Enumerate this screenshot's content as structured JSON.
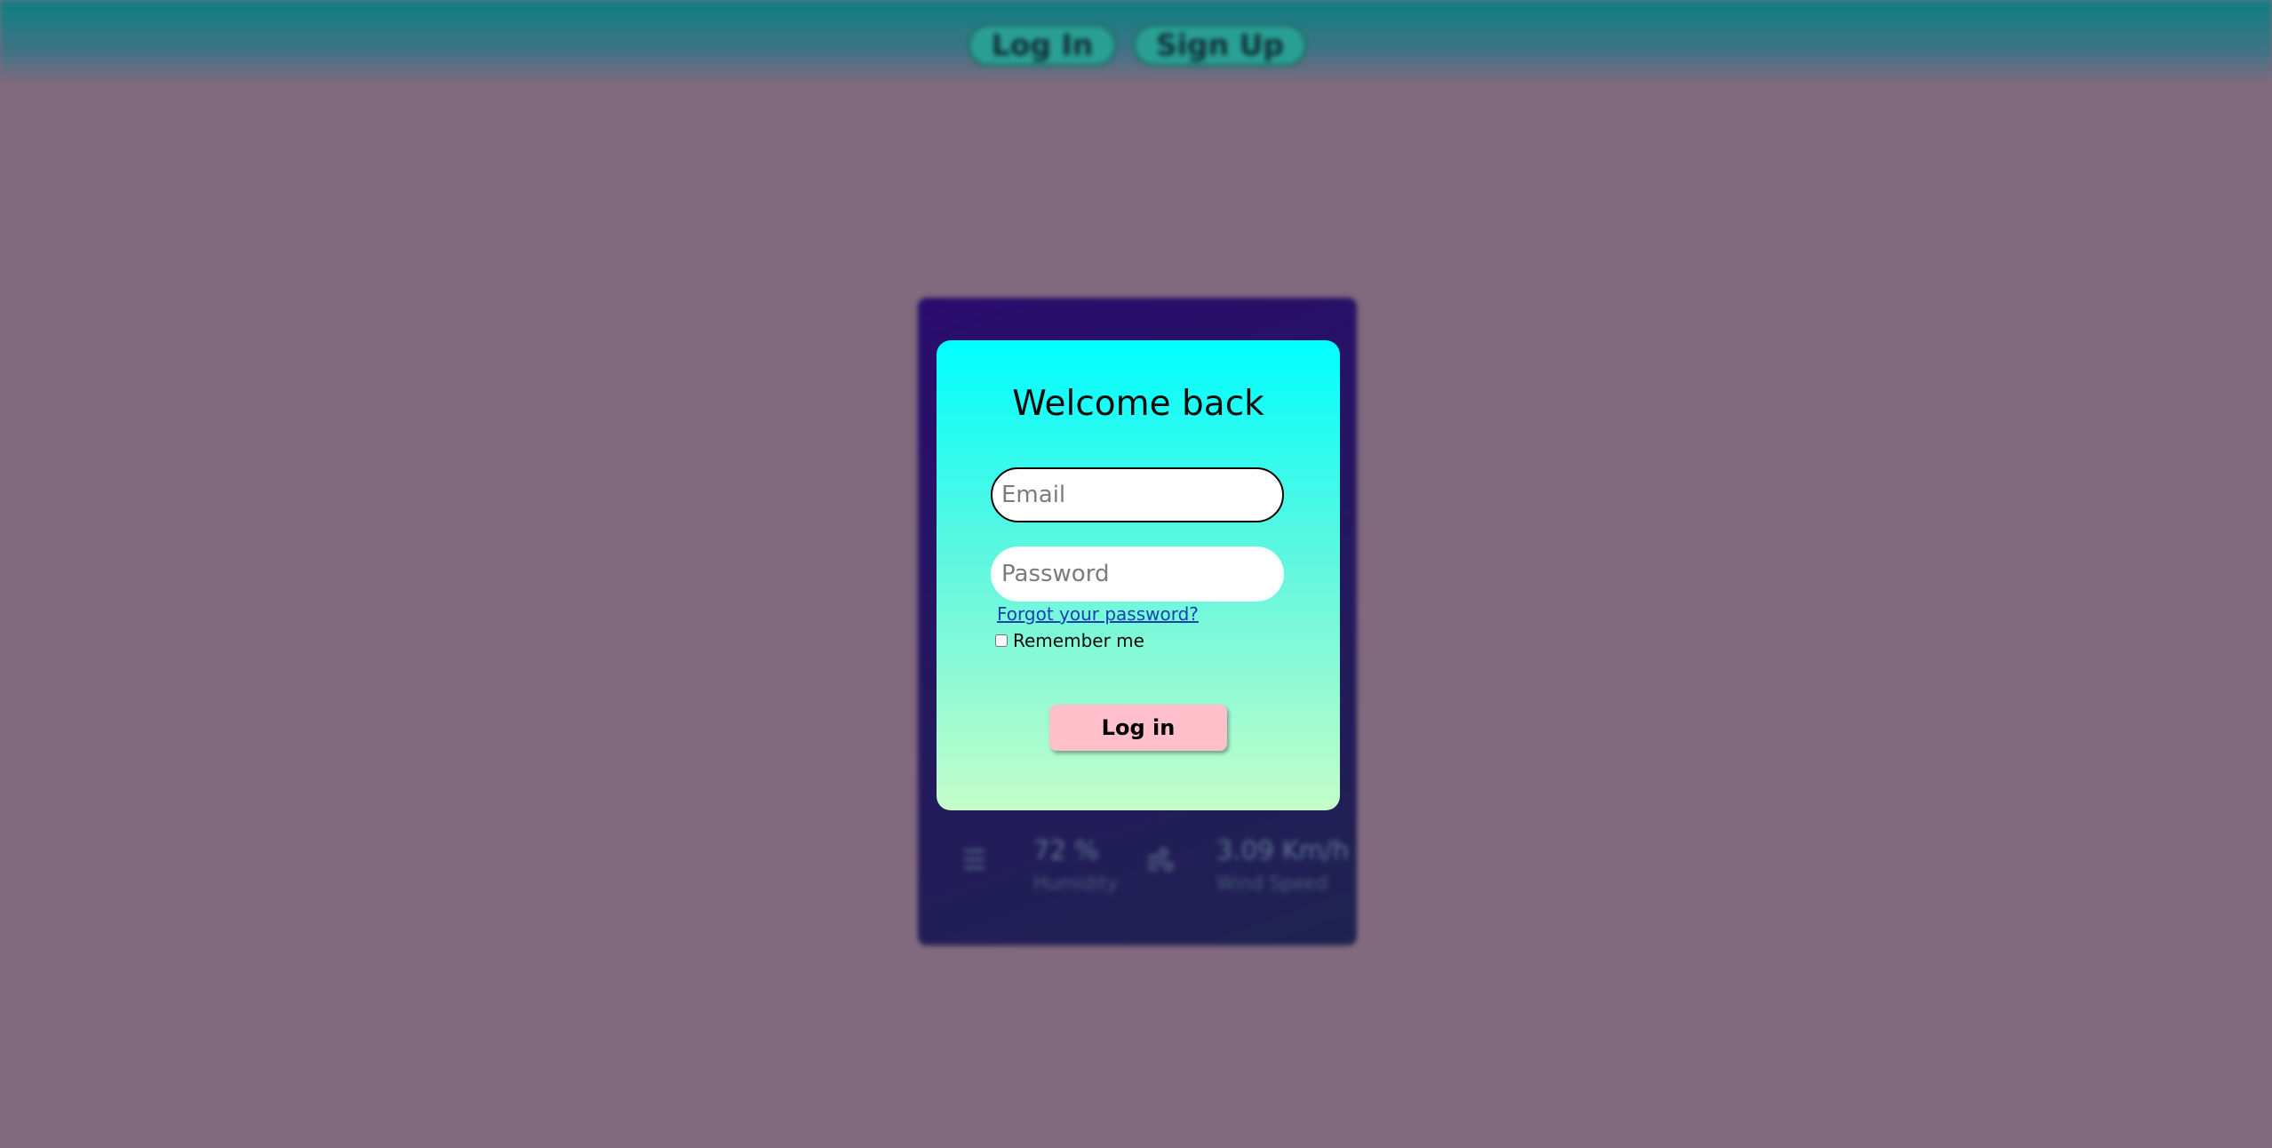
{
  "nav": {
    "login_label": "Log In",
    "signup_label": "Sign Up"
  },
  "weather": {
    "humidity": {
      "value": "72 %",
      "label": "Humidity",
      "icon": "humidity-icon"
    },
    "wind": {
      "value": "3.09 Km/h",
      "label": "Wind Speed",
      "icon": "wind-icon"
    }
  },
  "login": {
    "title": "Welcome back",
    "email_placeholder": "Email",
    "email_value": "",
    "password_placeholder": "Password",
    "password_value": "",
    "forgot_label": "Forgot your password?",
    "remember_label": "Remember me",
    "remember_checked": false,
    "submit_label": "Log in"
  },
  "colors": {
    "page_background": "#816a7e",
    "topbar": "#0d7f82",
    "card_gradient_top": "#00ffff",
    "card_gradient_bottom": "#c4fec9",
    "submit_button": "#ffc0cb",
    "weather_card": "#2a0c6e",
    "link": "#1a3fae"
  }
}
